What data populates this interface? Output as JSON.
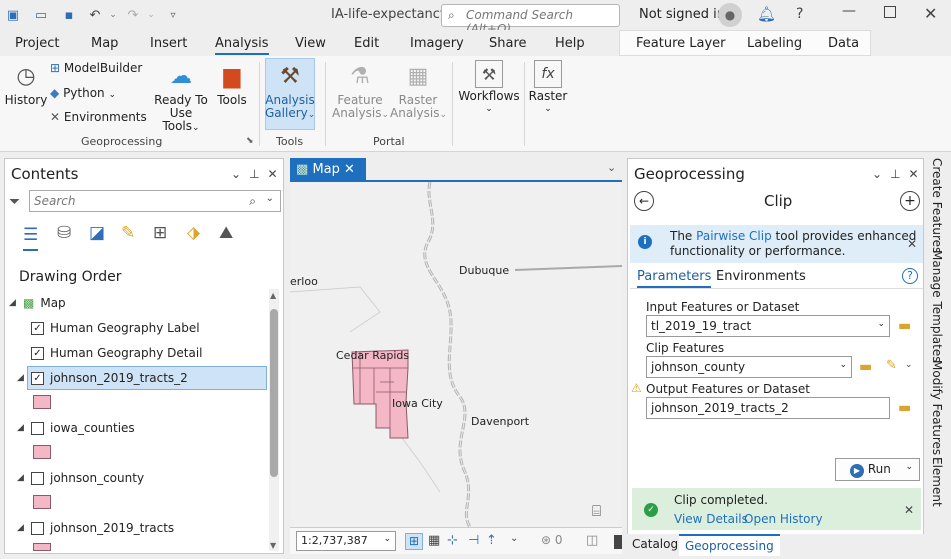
{
  "window": {
    "title": "IA-life-expectancy",
    "command_search_placeholder": "Command Search (Alt+Q)",
    "user": "Not signed in"
  },
  "menu": [
    "Project",
    "Map",
    "Insert",
    "Analysis",
    "View",
    "Edit",
    "Imagery",
    "Share",
    "Help"
  ],
  "context_tabs": [
    "Feature Layer",
    "Labeling",
    "Data"
  ],
  "ribbon": {
    "history": "History",
    "modelbuilder": "ModelBuilder",
    "python": "Python",
    "environments": "Environments",
    "ready1": "Ready To",
    "ready2": "Use Tools",
    "tools": "Tools",
    "gallery1": "Analysis",
    "gallery2": "Gallery",
    "feat1": "Feature",
    "feat2": "Analysis",
    "raster1": "Raster",
    "raster2": "Analysis",
    "workflows": "Workflows",
    "raster": "Raster",
    "groups": {
      "geoprocessing": "Geoprocessing",
      "tools": "Tools",
      "portal": "Portal"
    }
  },
  "contents": {
    "title": "Contents",
    "search_placeholder": "Search",
    "drawing_order": "Drawing Order",
    "layers": {
      "map": "Map",
      "hgl": "Human Geography Label",
      "hgd": "Human Geography Detail",
      "jt2": "johnson_2019_tracts_2",
      "ic": "iowa_counties",
      "jc": "johnson_county",
      "jt": "johnson_2019_tracts"
    }
  },
  "map": {
    "tab": "Map",
    "places": {
      "waterloo": "erloo",
      "dubuque": "Dubuque",
      "cedar_rapids": "Cedar Rapids",
      "iowa_city": "Iowa City",
      "davenport": "Davenport"
    },
    "scale": "1:2,737,387",
    "selected_count": "0",
    "colors": {
      "tracts_fill": "#f4b7c6",
      "tracts_stroke": "#8a5a6a",
      "boundary": "#9a9a9a"
    }
  },
  "gp": {
    "title": "Geoprocessing",
    "tool": "Clip",
    "info_pre": "The ",
    "info_link": "Pairwise Clip",
    "info_post": " tool provides enhanced",
    "info_line2": "functionality or performance.",
    "tab_params": "Parameters",
    "tab_env": "Environments",
    "input_label": "Input Features or Dataset",
    "input_value": "tl_2019_19_tract",
    "clip_label": "Clip Features",
    "clip_value": "johnson_county",
    "output_label": "Output Features or Dataset",
    "output_value": "johnson_2019_tracts_2",
    "run": "Run",
    "status": "Clip completed.",
    "view_details": "View Details",
    "open_history": "Open History"
  },
  "bottom_tabs": {
    "catalog": "Catalog",
    "geoprocessing": "Geoprocessing"
  },
  "side_tabs": [
    "Create Features",
    "Manage Templates",
    "Modify Features",
    "Element"
  ],
  "accent": "#1f6fbf"
}
